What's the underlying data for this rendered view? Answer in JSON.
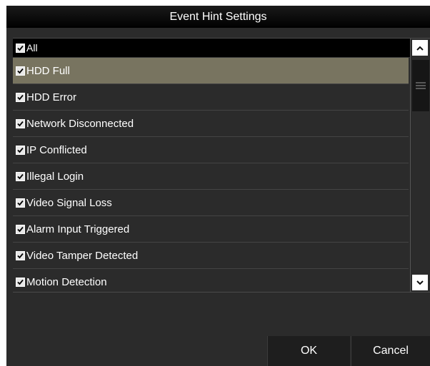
{
  "dialog": {
    "title": "Event Hint Settings"
  },
  "list": {
    "header": {
      "label": "All",
      "checked": true
    },
    "items": [
      {
        "label": "HDD Full",
        "checked": true,
        "selected": true
      },
      {
        "label": "HDD Error",
        "checked": true
      },
      {
        "label": "Network Disconnected",
        "checked": true
      },
      {
        "label": "IP Conflicted",
        "checked": true
      },
      {
        "label": "Illegal Login",
        "checked": true
      },
      {
        "label": "Video Signal Loss",
        "checked": true
      },
      {
        "label": "Alarm Input Triggered",
        "checked": true
      },
      {
        "label": "Video Tamper Detected",
        "checked": true
      },
      {
        "label": "Motion Detection",
        "checked": true
      }
    ]
  },
  "buttons": {
    "ok": "OK",
    "cancel": "Cancel"
  },
  "icons": {
    "checkbox": "checkbox-checked-icon",
    "scroll_up": "chevron-up-icon",
    "scroll_down": "chevron-down-icon",
    "scroll_thumb": "grip-lines-icon"
  },
  "colors": {
    "dialog_bg": "#2b2b2b",
    "titlebar_bg": "#000000",
    "selected_row": "#787460",
    "text": "#ffffff"
  }
}
